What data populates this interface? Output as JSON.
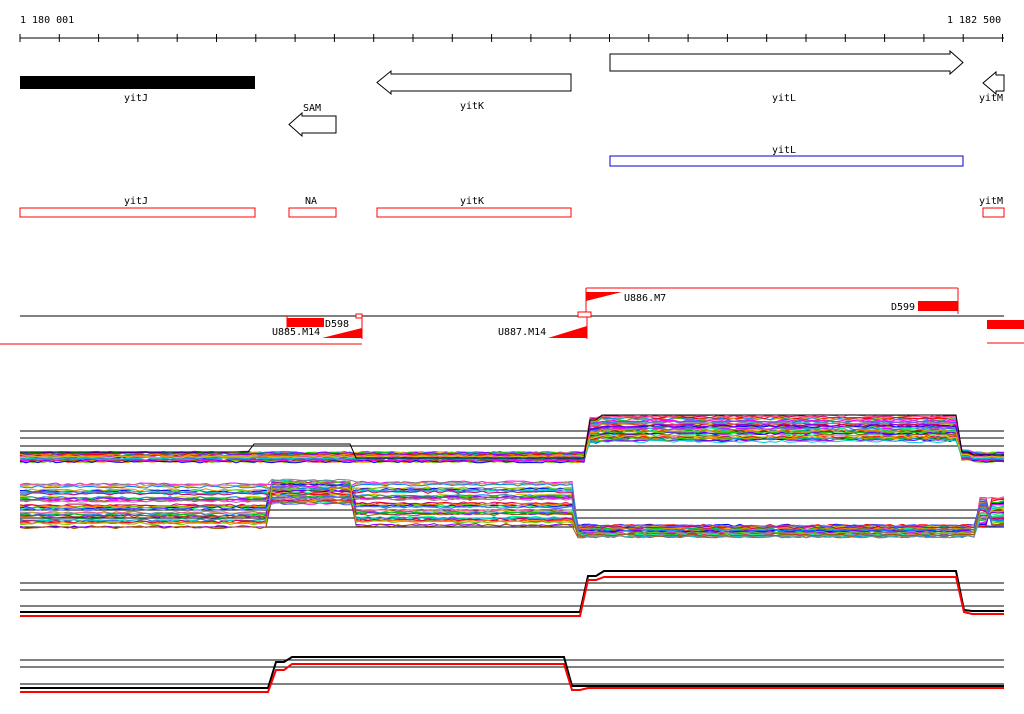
{
  "ruler": {
    "start_label": "1 180 001",
    "end_label": "1 182 500"
  },
  "annotated_genes": [
    {
      "name": "yitJ",
      "style": "solid",
      "strand": "none"
    },
    {
      "name": "SAM",
      "style": "arrow",
      "strand": "-"
    },
    {
      "name": "yitK",
      "style": "arrow",
      "strand": "-"
    },
    {
      "name": "yitL",
      "style": "arrow",
      "strand": "+"
    },
    {
      "name": "yitM",
      "style": "arrow",
      "strand": "-"
    }
  ],
  "blue_features": [
    {
      "name": "yitL"
    }
  ],
  "red_features": [
    {
      "name": "yitJ"
    },
    {
      "name": "NA"
    },
    {
      "name": "yitK"
    },
    {
      "name": "yitM"
    }
  ],
  "segment_labels": {
    "U886.M7": "U886.M7",
    "D599": "D599",
    "D598": "D598",
    "U885.M14": "U885.M14",
    "U887.M14": "U887.M14"
  },
  "colors": {
    "feature_red": "#ff0000",
    "feature_blue": "#0000cc",
    "gene_black": "#000000"
  }
}
